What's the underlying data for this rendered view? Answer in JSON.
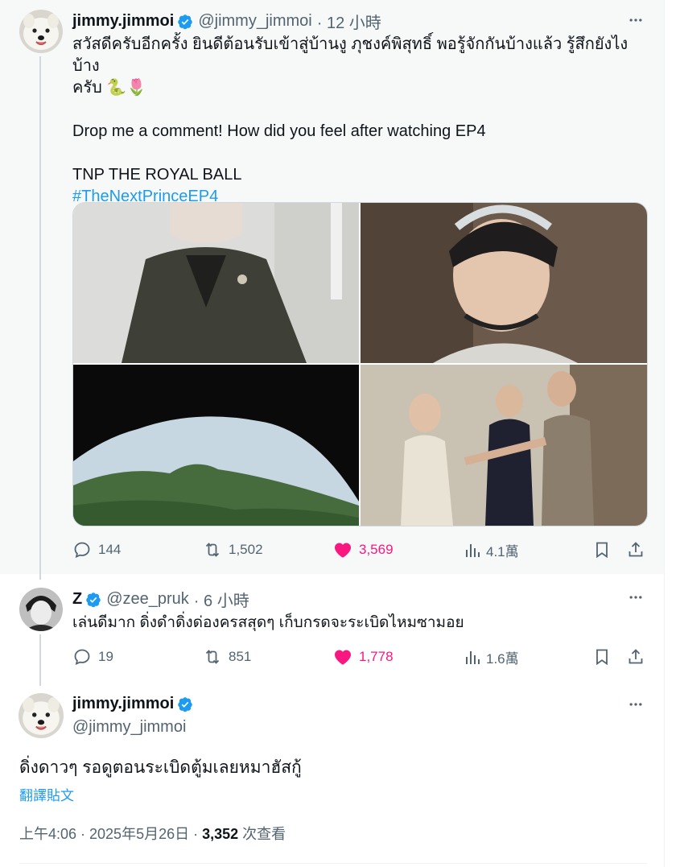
{
  "post1": {
    "display_name": "jimmy.jimmoi",
    "handle": "@jimmy_jimmoi",
    "time": "· 12 小時",
    "line1": "สวัสดีครับอีกครั้ง ยินดีต้อนรับเข้าสู่บ้านงู ภุชงค์พิสุทธิ์ พอรู้จักกันบ้างแล้ว รู้สึกยังไงบ้าง",
    "line2": "ครับ 🐍🌷",
    "line3": "Drop me a comment! How did you feel after watching EP4",
    "line4": "TNP THE ROYAL BALL",
    "hashtag": "#TheNextPrinceEP4",
    "replies": "144",
    "reposts": "1,502",
    "likes": "3,569",
    "views": "4.1萬"
  },
  "post2": {
    "display_name": "Z",
    "handle": "@zee_pruk",
    "time": "· 6 小時",
    "text": "เล่นดีมาก ดิ่งดำดิ่งด่องครสสุดๆ เก็บกรดจะระเบิดไหมซามอย",
    "replies": "19",
    "reposts": "851",
    "likes": "1,778",
    "views": "1.6萬"
  },
  "post3": {
    "display_name": "jimmy.jimmoi",
    "handle": "@jimmy_jimmoi",
    "text": "ดิ่งดาวๆ รอดูตอนระเบิดตู้มเลยหมาฮัสกู้",
    "translate": "翻譯貼文",
    "timestamp": "上午4:06 · 2025年5月26日 · ",
    "views_count": "3,352",
    "views_label": " 次查看"
  },
  "colors": {
    "accent": "#1d9bf0",
    "like": "#f91880",
    "muted": "#536471",
    "highlight_bg": "#f7f9f9"
  },
  "icons": [
    "more-icon",
    "reply-icon",
    "repost-icon",
    "like-icon",
    "views-icon",
    "bookmark-icon",
    "share-icon",
    "verified-icon"
  ]
}
